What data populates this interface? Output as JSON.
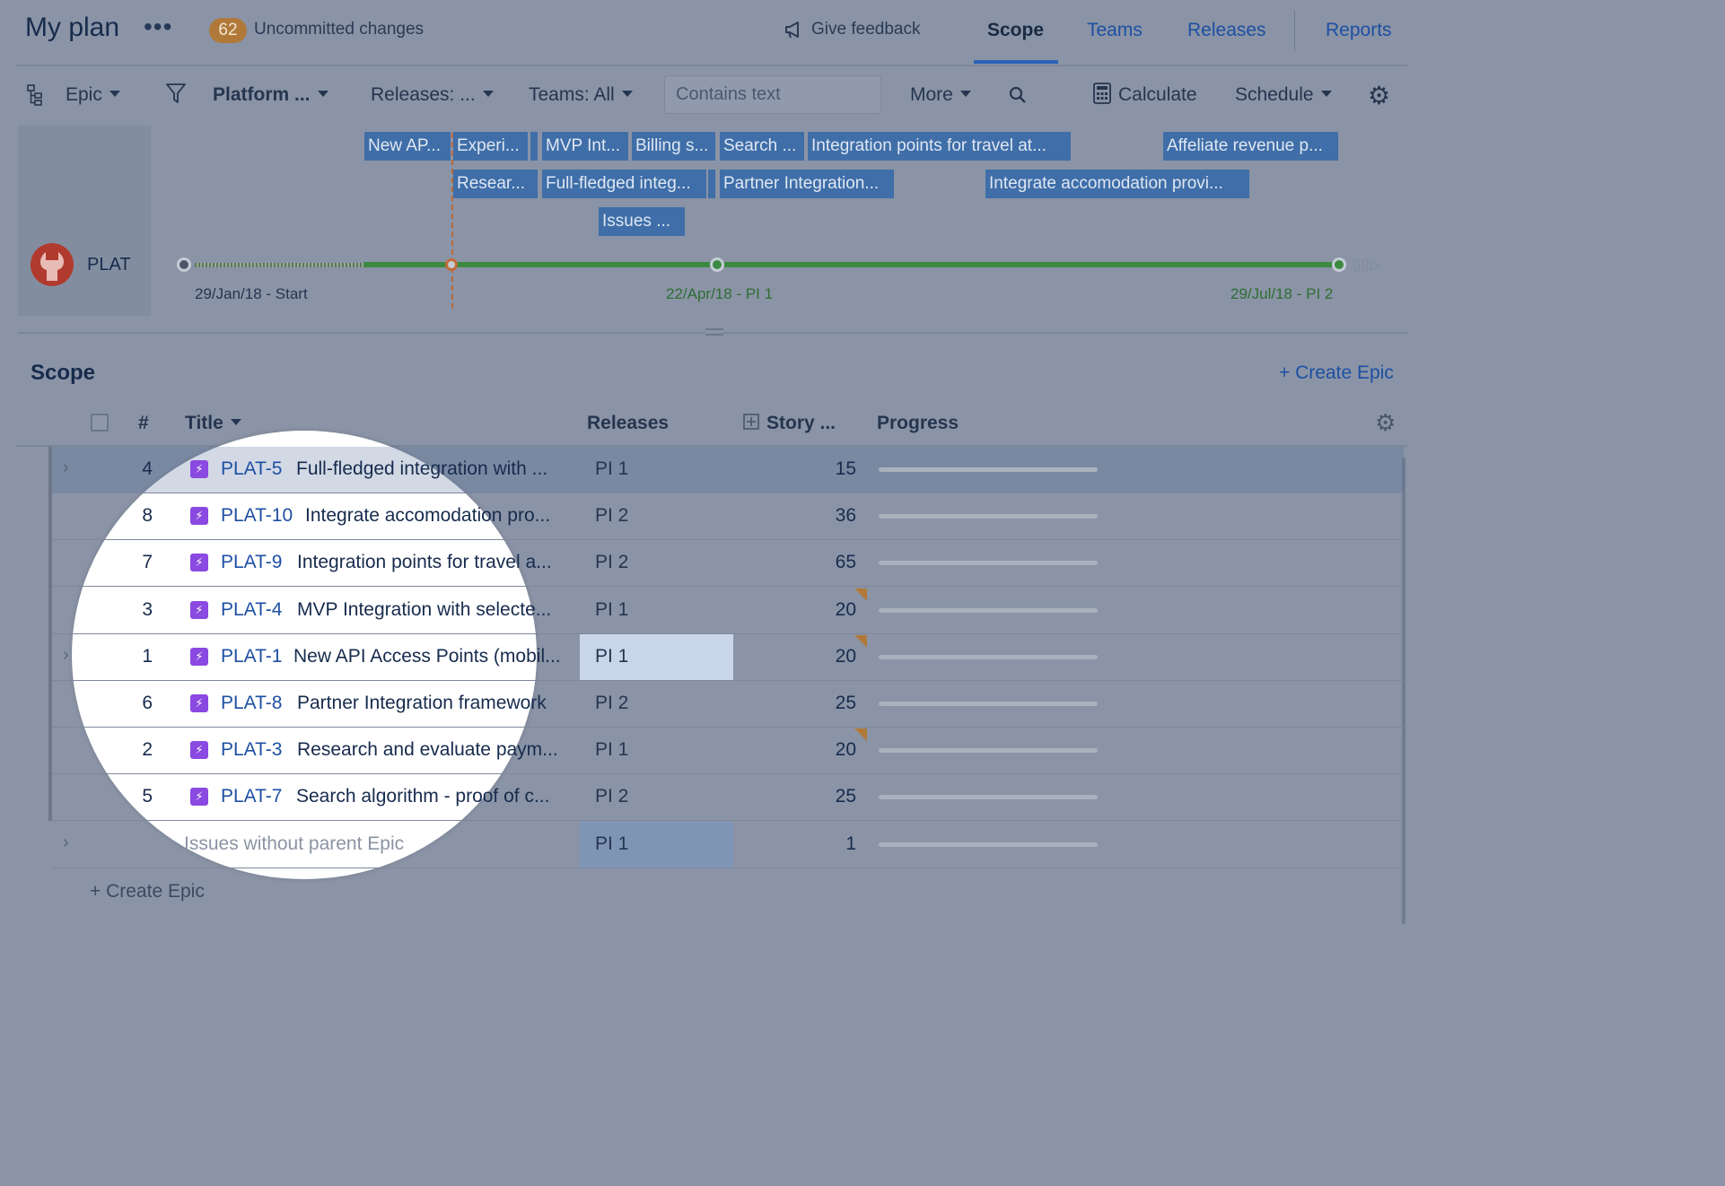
{
  "header": {
    "plan_title": "My plan",
    "more_dots": "•••",
    "uncommitted_count": "62",
    "uncommitted_label": "Uncommitted changes",
    "feedback_label": "Give feedback",
    "tabs": [
      {
        "label": "Scope",
        "active": true
      },
      {
        "label": "Teams",
        "active": false
      },
      {
        "label": "Releases",
        "active": false
      },
      {
        "label": "Reports",
        "active": false
      }
    ]
  },
  "toolbar": {
    "hierarchy_label": "Epic",
    "project_filter": "Platform ...",
    "releases_filter": "Releases: ...",
    "teams_filter": "Teams: All",
    "search_placeholder": "Contains text",
    "more_label": "More",
    "calculate_label": "Calculate",
    "schedule_label": "Schedule"
  },
  "timeline": {
    "project_label": "PLAT",
    "epic_bars": [
      "New AP...",
      "Experi...",
      "MVP Int...",
      "Billing s...",
      "Search ...",
      "Integration points for travel at...",
      "Affeliate revenue p...",
      "Resear...",
      "Full-fledged integ...",
      "Partner Integration...",
      "Integrate accomodation provi...",
      "Issues ..."
    ],
    "milestones": [
      {
        "label": "29/Jan/18 - Start"
      },
      {
        "label": "22/Apr/18 - PI 1"
      },
      {
        "label": "29/Jul/18 - PI 2"
      }
    ]
  },
  "scope": {
    "heading": "Scope",
    "create_epic_label": "+ Create Epic",
    "columns": {
      "rank": "#",
      "title": "Title",
      "releases": "Releases",
      "story": "Story ...",
      "progress": "Progress"
    },
    "rows": [
      {
        "rank": "4",
        "key": "PLAT-5",
        "title": "Full-fledged integration with ...",
        "release": "PI 1",
        "points": "15",
        "expandable": true,
        "warning": false
      },
      {
        "rank": "8",
        "key": "PLAT-10",
        "title": "Integrate accomodation pro...",
        "release": "PI 2",
        "points": "36",
        "expandable": false,
        "warning": false
      },
      {
        "rank": "7",
        "key": "PLAT-9",
        "title": "Integration points for travel a...",
        "release": "PI 2",
        "points": "65",
        "expandable": false,
        "warning": false
      },
      {
        "rank": "3",
        "key": "PLAT-4",
        "title": "MVP Integration with selecte...",
        "release": "PI 1",
        "points": "20",
        "expandable": false,
        "warning": true
      },
      {
        "rank": "1",
        "key": "PLAT-1",
        "title": "New API Access Points (mobil...",
        "release": "PI 1",
        "points": "20",
        "expandable": true,
        "warning": true
      },
      {
        "rank": "6",
        "key": "PLAT-8",
        "title": "Partner Integration framework",
        "release": "PI 2",
        "points": "25",
        "expandable": false,
        "warning": false
      },
      {
        "rank": "2",
        "key": "PLAT-3",
        "title": "Research and evaluate paym...",
        "release": "PI 1",
        "points": "20",
        "expandable": false,
        "warning": true
      },
      {
        "rank": "5",
        "key": "PLAT-7",
        "title": "Search algorithm - proof of c...",
        "release": "PI 2",
        "points": "25",
        "expandable": false,
        "warning": false
      }
    ],
    "orphan_row": {
      "title": "Issues without parent Epic",
      "release": "PI 1",
      "points": "1"
    },
    "create_epic_bottom_label": "+ Create Epic"
  },
  "colors": {
    "overlay_bg": "#8a94a6",
    "link_blue": "#1d4fa3",
    "epic_purple": "#8a49e0",
    "badge_orange": "#b0793a",
    "timeline_green": "#3c8a42"
  }
}
